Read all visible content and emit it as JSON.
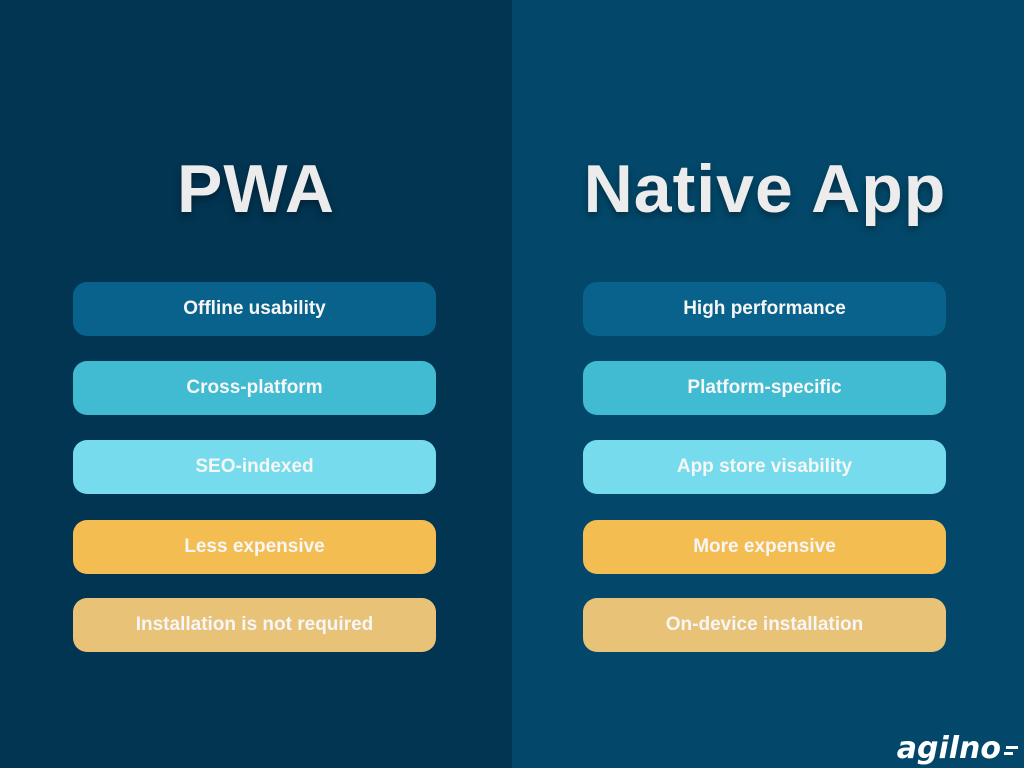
{
  "columns": [
    {
      "title": "PWA",
      "items": [
        {
          "label": "Offline usability",
          "color": "#08628c"
        },
        {
          "label": "Cross-platform",
          "color": "#41bbd1"
        },
        {
          "label": "SEO-indexed",
          "color": "#76dced"
        },
        {
          "label": "Less expensive",
          "color": "#f4bd52"
        },
        {
          "label": "Installation is not required",
          "color": "#e8c277"
        }
      ]
    },
    {
      "title": "Native App",
      "items": [
        {
          "label": "High performance",
          "color": "#08628c"
        },
        {
          "label": "Platform-specific",
          "color": "#41bbd1"
        },
        {
          "label": "App store visability",
          "color": "#76dced"
        },
        {
          "label": "More expensive",
          "color": "#f4bd52"
        },
        {
          "label": "On-device installation",
          "color": "#e8c277"
        }
      ]
    }
  ],
  "colors": {
    "left_background": "#023552",
    "right_background": "#03486a",
    "title_text": "#ececec"
  },
  "brand": {
    "name": "agilno",
    "icon": "agilno-mark-icon"
  }
}
